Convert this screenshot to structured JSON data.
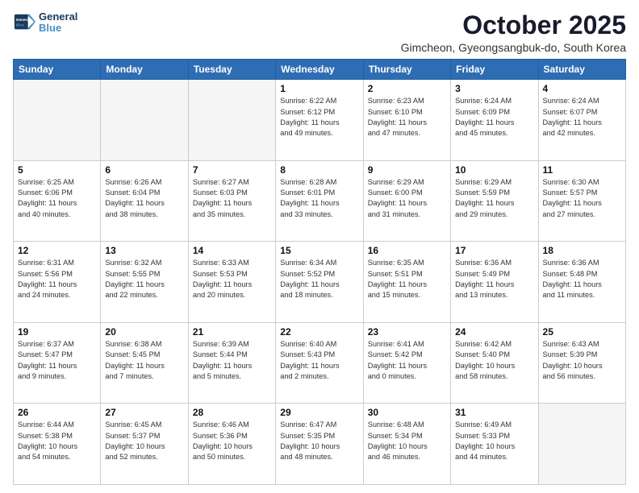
{
  "logo": {
    "line1": "General",
    "line2": "Blue"
  },
  "title": "October 2025",
  "subtitle": "Gimcheon, Gyeongsangbuk-do, South Korea",
  "header_days": [
    "Sunday",
    "Monday",
    "Tuesday",
    "Wednesday",
    "Thursday",
    "Friday",
    "Saturday"
  ],
  "weeks": [
    [
      {
        "day": "",
        "info": ""
      },
      {
        "day": "",
        "info": ""
      },
      {
        "day": "",
        "info": ""
      },
      {
        "day": "1",
        "info": "Sunrise: 6:22 AM\nSunset: 6:12 PM\nDaylight: 11 hours\nand 49 minutes."
      },
      {
        "day": "2",
        "info": "Sunrise: 6:23 AM\nSunset: 6:10 PM\nDaylight: 11 hours\nand 47 minutes."
      },
      {
        "day": "3",
        "info": "Sunrise: 6:24 AM\nSunset: 6:09 PM\nDaylight: 11 hours\nand 45 minutes."
      },
      {
        "day": "4",
        "info": "Sunrise: 6:24 AM\nSunset: 6:07 PM\nDaylight: 11 hours\nand 42 minutes."
      }
    ],
    [
      {
        "day": "5",
        "info": "Sunrise: 6:25 AM\nSunset: 6:06 PM\nDaylight: 11 hours\nand 40 minutes."
      },
      {
        "day": "6",
        "info": "Sunrise: 6:26 AM\nSunset: 6:04 PM\nDaylight: 11 hours\nand 38 minutes."
      },
      {
        "day": "7",
        "info": "Sunrise: 6:27 AM\nSunset: 6:03 PM\nDaylight: 11 hours\nand 35 minutes."
      },
      {
        "day": "8",
        "info": "Sunrise: 6:28 AM\nSunset: 6:01 PM\nDaylight: 11 hours\nand 33 minutes."
      },
      {
        "day": "9",
        "info": "Sunrise: 6:29 AM\nSunset: 6:00 PM\nDaylight: 11 hours\nand 31 minutes."
      },
      {
        "day": "10",
        "info": "Sunrise: 6:29 AM\nSunset: 5:59 PM\nDaylight: 11 hours\nand 29 minutes."
      },
      {
        "day": "11",
        "info": "Sunrise: 6:30 AM\nSunset: 5:57 PM\nDaylight: 11 hours\nand 27 minutes."
      }
    ],
    [
      {
        "day": "12",
        "info": "Sunrise: 6:31 AM\nSunset: 5:56 PM\nDaylight: 11 hours\nand 24 minutes."
      },
      {
        "day": "13",
        "info": "Sunrise: 6:32 AM\nSunset: 5:55 PM\nDaylight: 11 hours\nand 22 minutes."
      },
      {
        "day": "14",
        "info": "Sunrise: 6:33 AM\nSunset: 5:53 PM\nDaylight: 11 hours\nand 20 minutes."
      },
      {
        "day": "15",
        "info": "Sunrise: 6:34 AM\nSunset: 5:52 PM\nDaylight: 11 hours\nand 18 minutes."
      },
      {
        "day": "16",
        "info": "Sunrise: 6:35 AM\nSunset: 5:51 PM\nDaylight: 11 hours\nand 15 minutes."
      },
      {
        "day": "17",
        "info": "Sunrise: 6:36 AM\nSunset: 5:49 PM\nDaylight: 11 hours\nand 13 minutes."
      },
      {
        "day": "18",
        "info": "Sunrise: 6:36 AM\nSunset: 5:48 PM\nDaylight: 11 hours\nand 11 minutes."
      }
    ],
    [
      {
        "day": "19",
        "info": "Sunrise: 6:37 AM\nSunset: 5:47 PM\nDaylight: 11 hours\nand 9 minutes."
      },
      {
        "day": "20",
        "info": "Sunrise: 6:38 AM\nSunset: 5:45 PM\nDaylight: 11 hours\nand 7 minutes."
      },
      {
        "day": "21",
        "info": "Sunrise: 6:39 AM\nSunset: 5:44 PM\nDaylight: 11 hours\nand 5 minutes."
      },
      {
        "day": "22",
        "info": "Sunrise: 6:40 AM\nSunset: 5:43 PM\nDaylight: 11 hours\nand 2 minutes."
      },
      {
        "day": "23",
        "info": "Sunrise: 6:41 AM\nSunset: 5:42 PM\nDaylight: 11 hours\nand 0 minutes."
      },
      {
        "day": "24",
        "info": "Sunrise: 6:42 AM\nSunset: 5:40 PM\nDaylight: 10 hours\nand 58 minutes."
      },
      {
        "day": "25",
        "info": "Sunrise: 6:43 AM\nSunset: 5:39 PM\nDaylight: 10 hours\nand 56 minutes."
      }
    ],
    [
      {
        "day": "26",
        "info": "Sunrise: 6:44 AM\nSunset: 5:38 PM\nDaylight: 10 hours\nand 54 minutes."
      },
      {
        "day": "27",
        "info": "Sunrise: 6:45 AM\nSunset: 5:37 PM\nDaylight: 10 hours\nand 52 minutes."
      },
      {
        "day": "28",
        "info": "Sunrise: 6:46 AM\nSunset: 5:36 PM\nDaylight: 10 hours\nand 50 minutes."
      },
      {
        "day": "29",
        "info": "Sunrise: 6:47 AM\nSunset: 5:35 PM\nDaylight: 10 hours\nand 48 minutes."
      },
      {
        "day": "30",
        "info": "Sunrise: 6:48 AM\nSunset: 5:34 PM\nDaylight: 10 hours\nand 46 minutes."
      },
      {
        "day": "31",
        "info": "Sunrise: 6:49 AM\nSunset: 5:33 PM\nDaylight: 10 hours\nand 44 minutes."
      },
      {
        "day": "",
        "info": ""
      }
    ]
  ]
}
